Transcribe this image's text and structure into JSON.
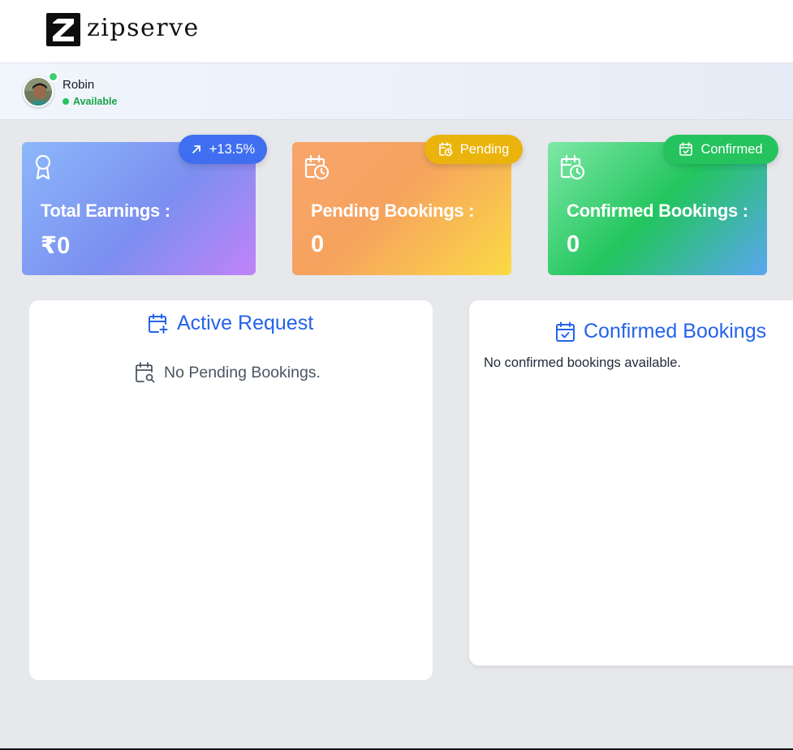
{
  "brand": {
    "name": "zipserve"
  },
  "user": {
    "name": "Robin",
    "status": "Available"
  },
  "stats": {
    "earnings": {
      "label": "Total Earnings :",
      "value": "₹0",
      "badge": "+13.5%"
    },
    "pending": {
      "label": "Pending Bookings :",
      "value": "0",
      "badge": "Pending"
    },
    "confirmed": {
      "label": "Confirmed Bookings :",
      "value": "0",
      "badge": "Confirmed"
    }
  },
  "panels": {
    "active": {
      "title": "Active Request",
      "empty_text": "No Pending Bookings."
    },
    "confirmed": {
      "title": "Confirmed Bookings",
      "empty_text": "No confirmed bookings available."
    }
  },
  "icons": {
    "logo": "z-logo-icon",
    "earnings": "award-icon",
    "growth": "arrow-up-right-icon",
    "pending": "calendar-clock-icon",
    "confirmed": "calendar-check-icon",
    "active_request": "calendar-plus-icon",
    "empty_active": "calendar-search-icon"
  },
  "colors": {
    "accent_blue": "#2563eb",
    "status_green": "#16a34a",
    "pending_yellow": "#eab40c",
    "confirmed_green": "#25c35e",
    "growth_blue": "#3f6ff0"
  }
}
